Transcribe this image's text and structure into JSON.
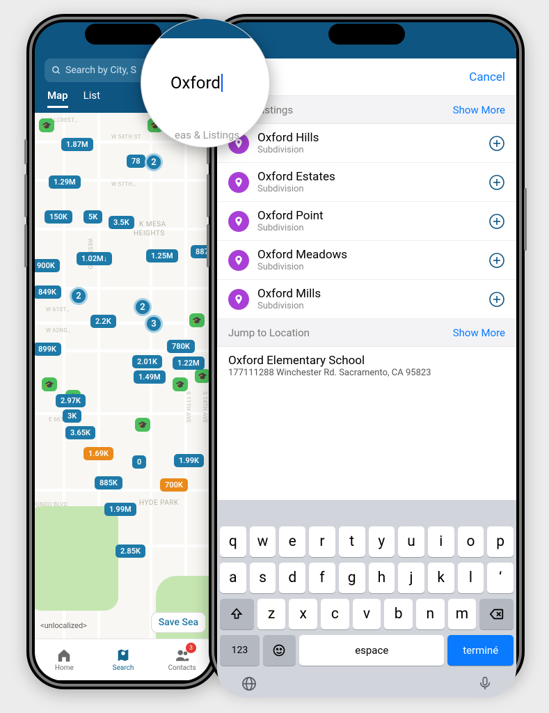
{
  "left": {
    "search_placeholder": "Search by City, S",
    "tabs": {
      "map": "Map",
      "list": "List"
    },
    "attribution": "<unlocalized>",
    "save_search": "Save Sea",
    "contacts_badge": "3",
    "nav": {
      "home": "Home",
      "search": "Search",
      "contacts": "Contacts"
    },
    "areas": {
      "mesa": "K MESA",
      "heights": "HEIGHTS",
      "hyde": "HYDE PARK"
    },
    "streets": {
      "s0": "ILLCREST…",
      "s1": "W 54TH ST",
      "s2": "W 57TH…",
      "s3": "W 61ST…",
      "s4": "W 62ND…",
      "s5": "E 66TH…",
      "s6": "DONDO BLVD",
      "s7": "S 11TH AVE",
      "s8": "S 14TH AVE",
      "s9": "WEST BLVD"
    },
    "pins": {
      "p0": "1.87M",
      "p1": "78",
      "p2": "1.29M",
      "p3": "150K",
      "p4": "5K",
      "p5": "3.5K",
      "p6": "900K",
      "p7": "1.02M↓",
      "p8": "1.25M",
      "p9": "887",
      "p10": "849K",
      "p11": "2.2K",
      "p12": "899K",
      "p13": "2.01K",
      "p14": "1.22M",
      "p15": "1.49M",
      "p16": "780K",
      "p17": "2.97K",
      "p18": "3K",
      "p19": "3.65K",
      "p20": "1.69K",
      "p21": "0",
      "p22": "1.99K",
      "p23": "885K",
      "p24": "700K",
      "p25": "1.99M",
      "p26": "2.85K"
    },
    "clusters": {
      "c0": "2",
      "c1": "2",
      "c2": "2",
      "c3": "3"
    }
  },
  "right": {
    "query": "Oxford",
    "cancel": "Cancel",
    "section_areas_label": "eas & Listings",
    "section_jump_label": "Jump to Location",
    "show_more": "Show More",
    "results": [
      {
        "title": "Oxford Hills",
        "sub": "Subdivision"
      },
      {
        "title": "Oxford Estates",
        "sub": "Subdivision"
      },
      {
        "title": "Oxford Point",
        "sub": "Subdivision"
      },
      {
        "title": "Oxford Meadows",
        "sub": "Subdivision"
      },
      {
        "title": "Oxford Mills",
        "sub": "Subdivision"
      }
    ],
    "location": {
      "title": "Oxford Elementary School",
      "sub": "177111288 Winchester Rd. Sacramento, CA 95823"
    }
  },
  "kb": {
    "r1": [
      "q",
      "w",
      "e",
      "r",
      "t",
      "y",
      "u",
      "i",
      "o",
      "p"
    ],
    "r2": [
      "a",
      "s",
      "d",
      "f",
      "g",
      "h",
      "j",
      "k",
      "l",
      "‘"
    ],
    "r3": [
      "z",
      "x",
      "c",
      "v",
      "b",
      "n",
      "m"
    ],
    "sym": "123",
    "space": "espace",
    "done": "terminé"
  },
  "mag": {
    "query": "Oxford",
    "peek": "eas & Listings"
  }
}
